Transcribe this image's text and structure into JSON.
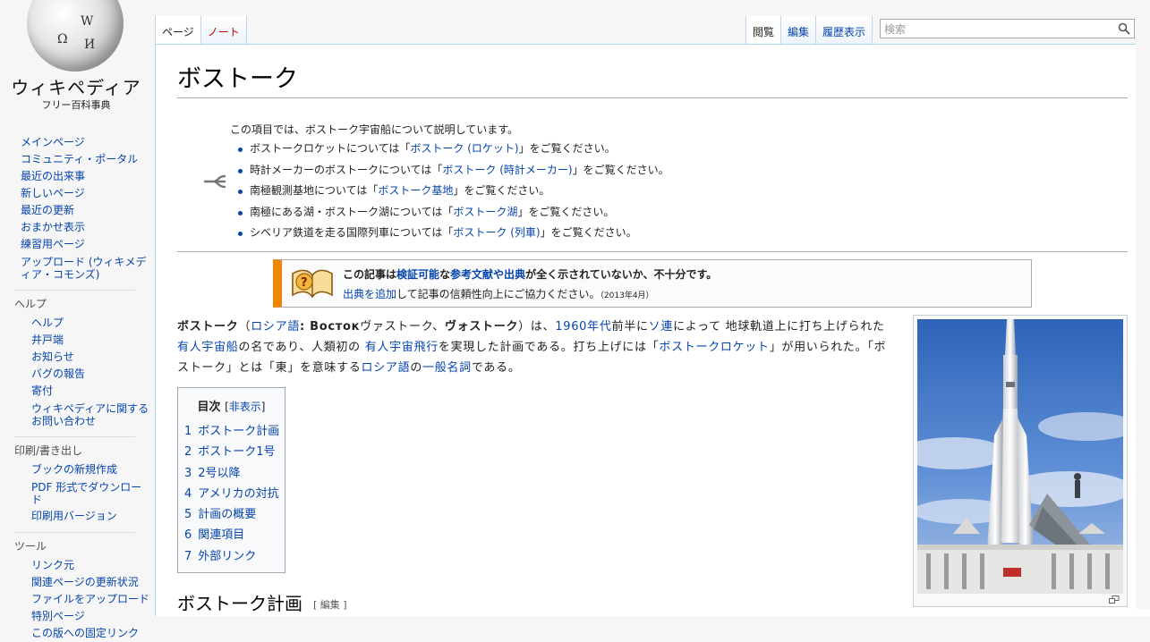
{
  "logo": {
    "wordmark": "ウィキペディア",
    "tagline": "フリー百科事典",
    "glyphs": [
      "Ω",
      "W",
      "И"
    ]
  },
  "sidebar": {
    "navigation": [
      "メインページ",
      "コミュニティ・ポータル",
      "最近の出来事",
      "新しいページ",
      "最近の更新",
      "おまかせ表示",
      "練習用ページ",
      "アップロード (ウィキメディア・コモンズ)"
    ],
    "help": {
      "heading": "ヘルプ",
      "items": [
        "ヘルプ",
        "井戸端",
        "お知らせ",
        "バグの報告",
        "寄付",
        "ウィキペディアに関するお問い合わせ"
      ]
    },
    "print": {
      "heading": "印刷/書き出し",
      "items": [
        "ブックの新規作成",
        "PDF 形式でダウンロード",
        "印刷用バージョン"
      ]
    },
    "tools": {
      "heading": "ツール",
      "items": [
        "リンク元",
        "関連ページの更新状況",
        "ファイルをアップロード",
        "特別ページ",
        "この版への固定リンク"
      ]
    }
  },
  "tabs": {
    "page": "ページ",
    "talk": "ノート",
    "read": "閲覧",
    "edit": "編集",
    "history": "履歴表示"
  },
  "search": {
    "placeholder": "検索",
    "value": ""
  },
  "article": {
    "title": "ボストーク",
    "dablink": {
      "intro": "この項目では、ボストーク宇宙船について説明しています。",
      "items": [
        {
          "pre": "ボストークロケットについては「",
          "link": "ボストーク (ロケット)",
          "post": "」をご覧ください。"
        },
        {
          "pre": "時計メーカーのボストークについては「",
          "link": "ボストーク (時計メーカー)",
          "post": "」をご覧ください。"
        },
        {
          "pre": "南極観測基地については「",
          "link": "ボストーク基地",
          "post": "」をご覧ください。"
        },
        {
          "pre": "南極にある湖・ボストーク湖については「",
          "link": "ボストーク湖",
          "post": "」をご覧ください。"
        },
        {
          "pre": "シベリア鉄道を走る国際列車については「",
          "link": "ボストーク (列車)",
          "post": "」をご覧ください。"
        }
      ]
    },
    "ambox": {
      "t1": "この記事は",
      "l1": "検証可能",
      "t2": "な",
      "l2": "参考文献や出典",
      "t3": "が全く示されていないか、不十分です。",
      "l3": "出典を追加",
      "t4": "して記事の信頼性向上にご協力ください。",
      "date": "（2013年4月）"
    },
    "lead": {
      "b1": "ボストーク",
      "p1": "（",
      "l1": "ロシア語",
      "p2": ": ",
      "b2": "Восток",
      "p3": "ヴァストーク、",
      "b3": "ヴォストーク",
      "p4": "）は、",
      "l2": "1960年代",
      "p5": "前半に",
      "l3": "ソ連",
      "p6": "によって 地球軌道上に打ち上げられた ",
      "l4": "有人宇宙船",
      "p7": "の名であり、人類初の ",
      "l5": "有人宇宙飛行",
      "p8": "を実現した計画である。打ち上げには「",
      "l6": "ボストークロケット",
      "p9": "」が用いられた。「ボストーク」とは「東」を意味する",
      "l7": "ロシア語",
      "p10": "の",
      "l8": "一般名詞",
      "p11": "である。"
    },
    "toc": {
      "title": "目次",
      "toggle_open": "[",
      "toggle": "非表示",
      "toggle_close": "]",
      "items": [
        {
          "num": "1",
          "label": "ボストーク計画"
        },
        {
          "num": "2",
          "label": "ボストーク1号"
        },
        {
          "num": "3",
          "label": "2号以降"
        },
        {
          "num": "4",
          "label": "アメリカの対抗"
        },
        {
          "num": "5",
          "label": "計画の概要"
        },
        {
          "num": "6",
          "label": "関連項目"
        },
        {
          "num": "7",
          "label": "外部リンク"
        }
      ]
    },
    "section1": {
      "title": "ボストーク計画",
      "edit": "[ 編集 ]"
    }
  },
  "colors": {
    "link": "#0645ad",
    "ambox_border": "#f28500",
    "redlink": "#ba0000"
  }
}
